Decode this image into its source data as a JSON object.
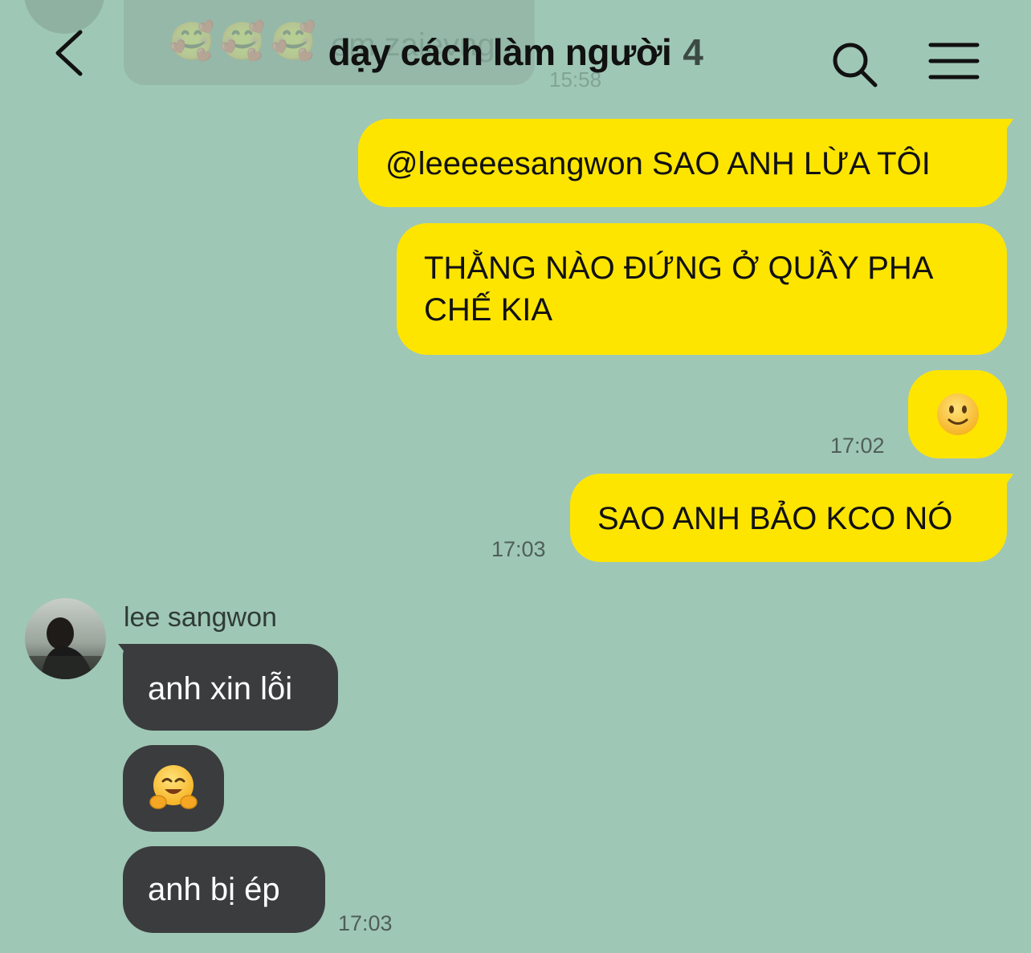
{
  "previous_message": {
    "emojis": "🥰🥰🥰",
    "text": "em zaievng",
    "time": "15:58"
  },
  "header": {
    "title": "dạy cách làm người",
    "member_count": "4"
  },
  "messages_outgoing": [
    {
      "text": "@leeeeesangwon SAO ANH LỪA TÔI"
    },
    {
      "text": "THẰNG NÀO ĐỨNG Ở QUẦY PHA CHẾ KIA"
    },
    {
      "emoji": "slightly-smiling-face",
      "time": "17:02"
    },
    {
      "text": "SAO ANH BẢO KCO NÓ",
      "time": "17:03"
    }
  ],
  "sender": {
    "name": "lee sangwon"
  },
  "messages_incoming": [
    {
      "text": "anh xin lỗi"
    },
    {
      "emoji": "hugging-face"
    },
    {
      "text": "anh bị ép",
      "time": "17:03"
    }
  ],
  "colors": {
    "background": "#9fc7b6",
    "outgoing_bubble": "#fee500",
    "incoming_bubble": "#3b3c3e"
  }
}
